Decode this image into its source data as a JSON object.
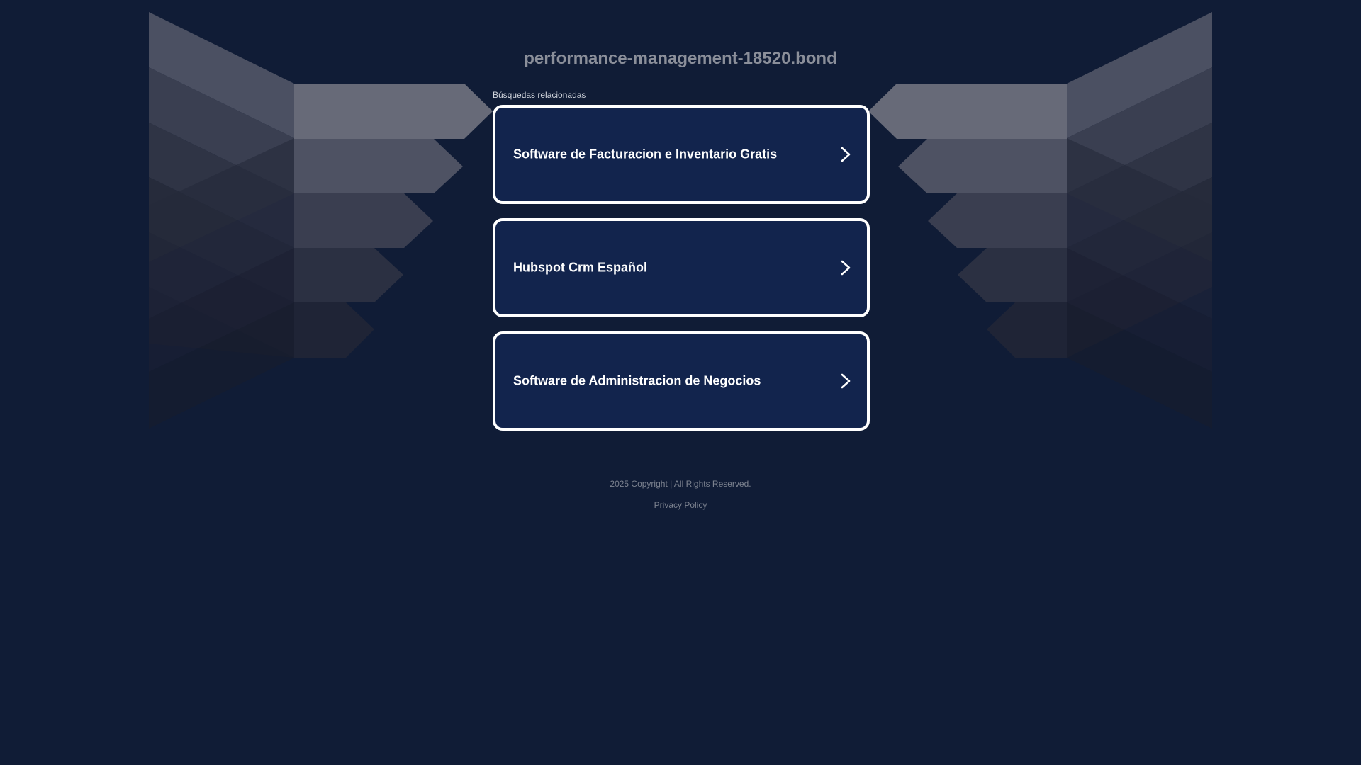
{
  "site": {
    "domain": "performance-management-18520.bond"
  },
  "related": {
    "label": "Búsquedas relacionadas",
    "links": [
      {
        "label": "Software de Facturacion e Inventario Gratis"
      },
      {
        "label": "Hubspot Crm Español"
      },
      {
        "label": "Software de Administracion de Negocios"
      }
    ]
  },
  "footer": {
    "copyright": "2025 Copyright | All Rights Reserved.",
    "privacy_label": "Privacy Policy"
  },
  "colors": {
    "background": "#101c36",
    "box_background": "#12244d",
    "box_border": "#ffffff",
    "title": "#8b8f9a"
  },
  "icons": {
    "link_arrow": "chevron-right-icon"
  }
}
